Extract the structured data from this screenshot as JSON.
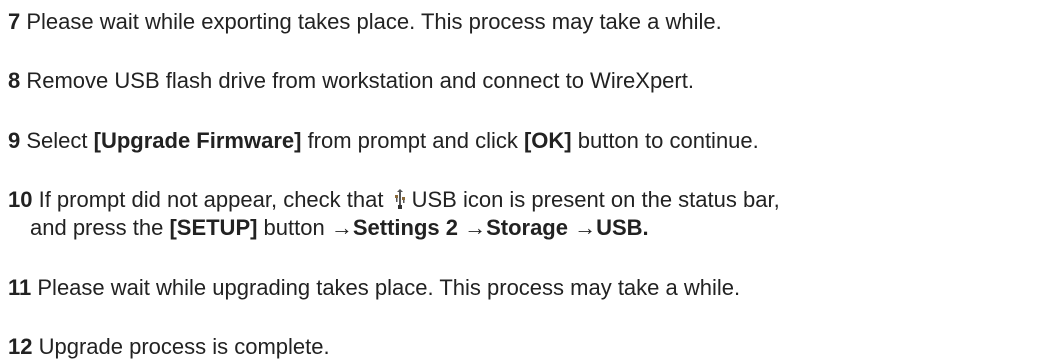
{
  "steps": [
    {
      "num": "7",
      "text": " Please wait while exporting takes place. This process may take a while."
    },
    {
      "num": "8",
      "text": " Remove USB flash drive from workstation and connect to WireXpert."
    },
    {
      "num": "9",
      "pre": " Select ",
      "b1": "[Upgrade Firmware]",
      "mid": " from prompt and click ",
      "b2": "[OK]",
      "post": " button to continue."
    },
    {
      "num": "10",
      "pre": " If prompt did not appear, check that ",
      "icon": "usb-icon",
      "mid": "USB icon is present on the status bar,",
      "line2_pre": "and press the ",
      "b1": "[SETUP]",
      "line2_mid": " button ",
      "b2": "→Settings 2 →Storage →USB."
    },
    {
      "num": "11",
      "text": " Please wait while upgrading takes place. This process may take a while."
    },
    {
      "num": "12",
      "text": " Upgrade process is complete."
    }
  ]
}
